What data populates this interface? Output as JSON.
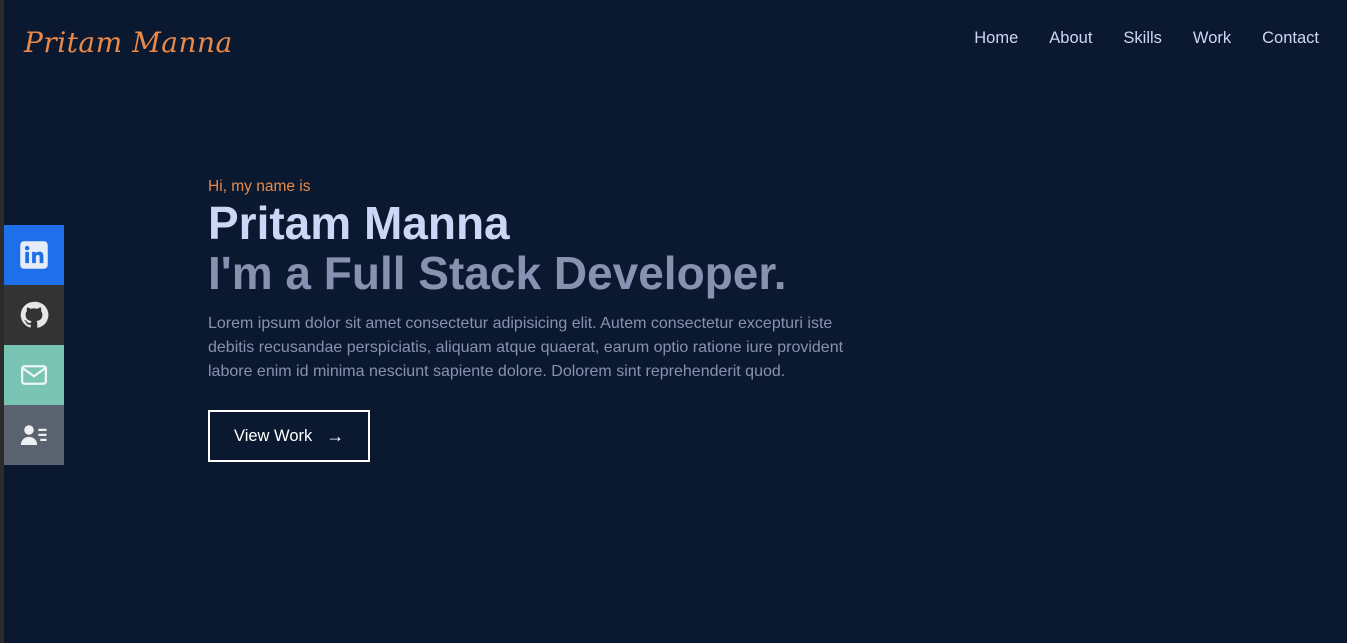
{
  "header": {
    "logo": "Pritam Manna",
    "nav": [
      {
        "label": "Home"
      },
      {
        "label": "About"
      },
      {
        "label": "Skills"
      },
      {
        "label": "Work"
      },
      {
        "label": "Contact"
      }
    ]
  },
  "socials": [
    {
      "icon": "linkedin-icon",
      "color": "#1f6feb"
    },
    {
      "icon": "github-icon",
      "color": "#333333"
    },
    {
      "icon": "mail-icon",
      "color": "#7ac4b4"
    },
    {
      "icon": "resume-icon",
      "color": "#5b6270"
    }
  ],
  "hero": {
    "greeting": "Hi, my name is",
    "name": "Pritam Manna",
    "role": "I'm a Full Stack Developer.",
    "description": "Lorem ipsum dolor sit amet consectetur adipisicing elit. Autem consectetur excepturi iste debitis recusandae perspiciatis, aliquam atque quaerat, earum optio ratione iure provident labore enim id minima nesciunt sapiente dolore. Dolorem sint reprehenderit quod.",
    "cta_label": "View Work",
    "cta_arrow": "→"
  },
  "colors": {
    "background": "#0a192f",
    "accent": "#e8894a",
    "heading": "#ccd6f6",
    "muted": "#8892b0"
  }
}
